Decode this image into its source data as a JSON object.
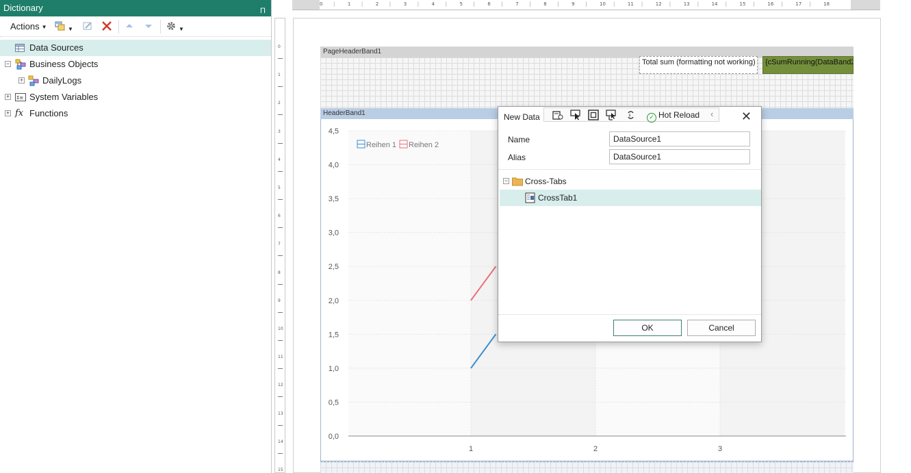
{
  "dictionary": {
    "title": "Dictionary",
    "pin_glyph": "Π",
    "toolbar": {
      "actions_label": "Actions",
      "icons": [
        "new-item-icon",
        "edit-icon",
        "delete-icon",
        "move-up-icon",
        "move-down-icon",
        "settings-icon"
      ]
    },
    "tree": [
      {
        "label": "Data Sources",
        "selected": true,
        "icon": "data-sources-icon"
      },
      {
        "label": "Business Objects",
        "icon": "business-objects-icon"
      },
      {
        "label": "DailyLogs",
        "icon": "business-object-icon"
      },
      {
        "label": "System Variables",
        "icon": "system-variables-icon"
      },
      {
        "label": "Functions",
        "icon": "functions-icon",
        "glyph": "fx"
      }
    ]
  },
  "ruler": {
    "h_numbers": [
      "0",
      "1",
      "2",
      "3",
      "4",
      "5",
      "6",
      "7",
      "8",
      "9",
      "10",
      "11",
      "12",
      "13",
      "14",
      "15",
      "16",
      "17",
      "18"
    ],
    "v_numbers": [
      "0",
      "1",
      "2",
      "3",
      "4",
      "5",
      "6",
      "7",
      "8",
      "9",
      "10",
      "11",
      "12",
      "13",
      "14",
      "15"
    ]
  },
  "report": {
    "page_header_band": "PageHeaderBand1",
    "header_band": "HeaderBand1",
    "total_text": "Total sum (formatting not working)",
    "sum_expression": "{cSumRunning(DataBand2"
  },
  "chart_data": {
    "type": "line",
    "categories": [
      "1",
      "2",
      "3"
    ],
    "y_ticks": [
      "0,0",
      "0,5",
      "1,0",
      "1,5",
      "2,0",
      "2,5",
      "3,0",
      "3,5",
      "4,0",
      "4,5"
    ],
    "ylim": [
      0,
      4.5
    ],
    "legend": "top-left",
    "grid": true,
    "series": [
      {
        "name": "Reihen 1",
        "color": "#3a8fd1",
        "points": [
          [
            1,
            1.0
          ],
          [
            1.2,
            1.5
          ]
        ]
      },
      {
        "name": "Reihen 2",
        "color": "#e8737a",
        "points": [
          [
            1,
            2.0
          ],
          [
            1.2,
            2.5
          ]
        ]
      }
    ]
  },
  "dialog": {
    "title": "New Data",
    "hot_reload": "Hot Reload",
    "strip_icons": [
      "add-component-icon",
      "select-icon",
      "frame-icon",
      "resize-icon",
      "refresh-icon"
    ],
    "name_label": "Name",
    "name_value": "DataSource1",
    "alias_label": "Alias",
    "alias_value": "DataSource1",
    "tree": [
      {
        "label": "Cross-Tabs",
        "icon": "folder-icon"
      },
      {
        "label": "CrossTab1",
        "icon": "crosstab-icon",
        "selected": true
      }
    ],
    "ok_label": "OK",
    "cancel_label": "Cancel"
  }
}
